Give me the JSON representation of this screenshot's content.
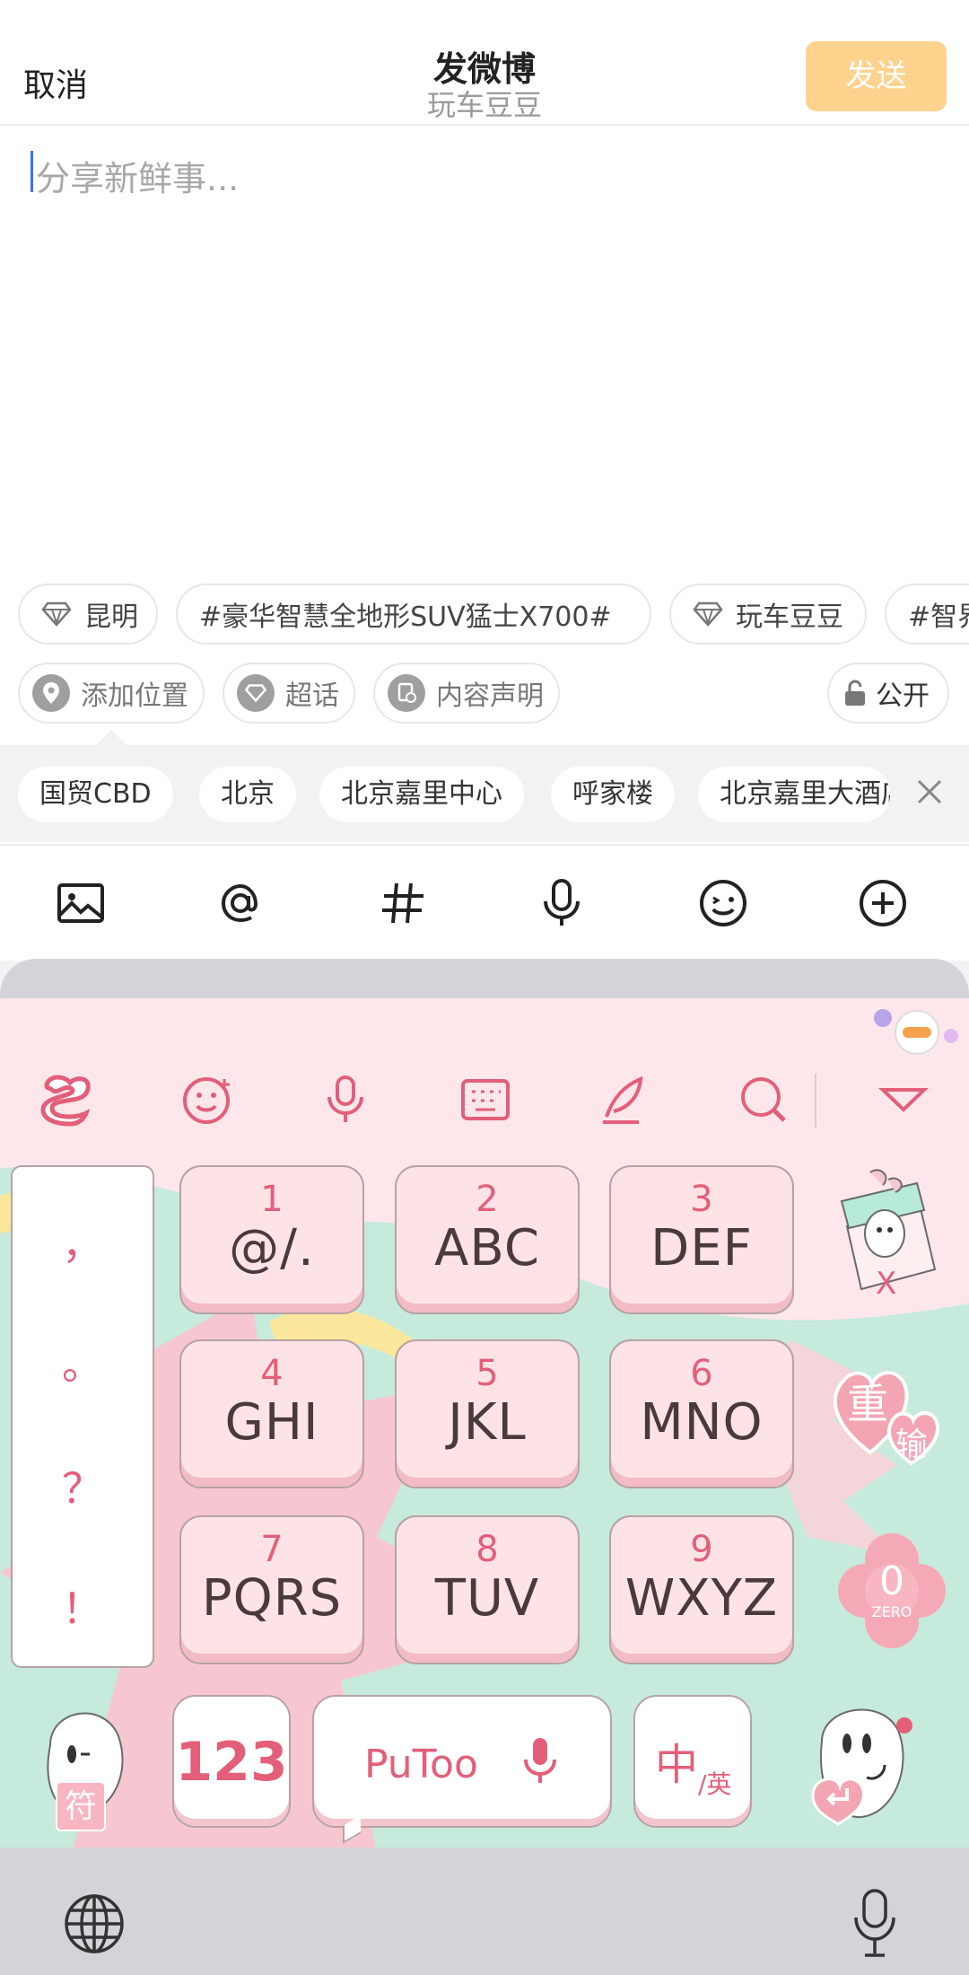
{
  "header": {
    "cancel_label": "取消",
    "title": "发微博",
    "subtitle": "玩车豆豆",
    "send_label": "发送"
  },
  "compose": {
    "placeholder": "分享新鲜事..."
  },
  "topic_chips": [
    {
      "label": "昆明",
      "icon": "diamond-icon"
    },
    {
      "label": "#豪华智慧全地形SUV猛士X700#",
      "icon": ""
    },
    {
      "label": "玩车豆豆",
      "icon": "diamond-icon"
    },
    {
      "label": "#智界",
      "icon": ""
    }
  ],
  "action_chips": {
    "location": "添加位置",
    "supertopic": "超话",
    "statement": "内容声明",
    "visibility": "公开"
  },
  "location_suggestions": [
    "国贸CBD",
    "北京",
    "北京嘉里中心",
    "呼家楼",
    "北京嘉里大酒店"
  ],
  "toolbar": [
    "image-icon",
    "at-icon",
    "hashtag-icon",
    "microphone-icon",
    "emoji-icon",
    "plus-icon"
  ],
  "keyboard": {
    "top_icons": [
      "sogou-logo-icon",
      "emoji-icon",
      "microphone-icon",
      "keyboard-icon",
      "pen-icon",
      "search-icon",
      "collapse-icon"
    ],
    "punctuation": [
      "，",
      "。",
      "？",
      "！"
    ],
    "keys": [
      {
        "num": "1",
        "letters": "@/."
      },
      {
        "num": "2",
        "letters": "ABC"
      },
      {
        "num": "3",
        "letters": "DEF"
      },
      {
        "num": "4",
        "letters": "GHI"
      },
      {
        "num": "5",
        "letters": "JKL"
      },
      {
        "num": "6",
        "letters": "MNO"
      },
      {
        "num": "7",
        "letters": "PQRS"
      },
      {
        "num": "8",
        "letters": "TUV"
      },
      {
        "num": "9",
        "letters": "WXYZ"
      }
    ],
    "delete_label": "X",
    "retype_label_1": "重",
    "retype_label_2": "输",
    "zero_label": "0",
    "zero_sub": "ZERO",
    "symbol_label": "符",
    "num_label": "123",
    "space_label": "PuToo",
    "lang_main": "中",
    "lang_sub": "/英",
    "theme_colors": {
      "pink": "#fde7ea",
      "mint": "#c6eadc",
      "accent": "#e35f79"
    }
  },
  "system_bar": [
    "globe-icon",
    "microphone-icon"
  ],
  "colors": {
    "send_disabled": "#ffd28e",
    "caret": "#3d6fff"
  }
}
